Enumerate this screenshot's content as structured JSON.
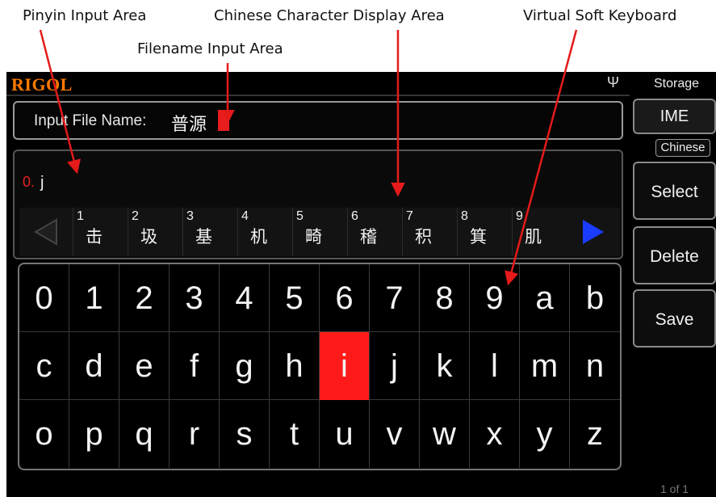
{
  "annotations": {
    "pinyin": "Pinyin Input Area",
    "display": "Chinese Character Display Area",
    "keyboard": "Virtual Soft Keyboard",
    "filename": "Filename Input Area"
  },
  "header": {
    "logo": "RIGOL",
    "usb_icon": "usb-icon"
  },
  "file_name": {
    "label": "Input File Name:",
    "value": "普源"
  },
  "pinyin": {
    "index": "0.",
    "value": "j"
  },
  "candidates": [
    {
      "num": "1",
      "char": "击"
    },
    {
      "num": "2",
      "char": "圾"
    },
    {
      "num": "3",
      "char": "基"
    },
    {
      "num": "4",
      "char": "机"
    },
    {
      "num": "5",
      "char": "畸"
    },
    {
      "num": "6",
      "char": "稽"
    },
    {
      "num": "7",
      "char": "积"
    },
    {
      "num": "8",
      "char": "箕"
    },
    {
      "num": "9",
      "char": "肌"
    }
  ],
  "keyboard": {
    "rows": [
      [
        "0",
        "1",
        "2",
        "3",
        "4",
        "5",
        "6",
        "7",
        "8",
        "9",
        "a",
        "b"
      ],
      [
        "c",
        "d",
        "e",
        "f",
        "g",
        "h",
        "i",
        "j",
        "k",
        "l",
        "m",
        "n"
      ],
      [
        "o",
        "p",
        "q",
        "r",
        "s",
        "t",
        "u",
        "v",
        "w",
        "x",
        "y",
        "z"
      ]
    ],
    "selected": "i"
  },
  "menu": {
    "title": "Storage",
    "ime": "IME",
    "ime_mode": "Chinese",
    "select": "Select",
    "delete": "Delete",
    "save": "Save",
    "page": "1 of 1"
  },
  "colors": {
    "accent": "#ff1a1a",
    "logo": "#ff7a00",
    "arrow_active": "#1a3cff"
  }
}
